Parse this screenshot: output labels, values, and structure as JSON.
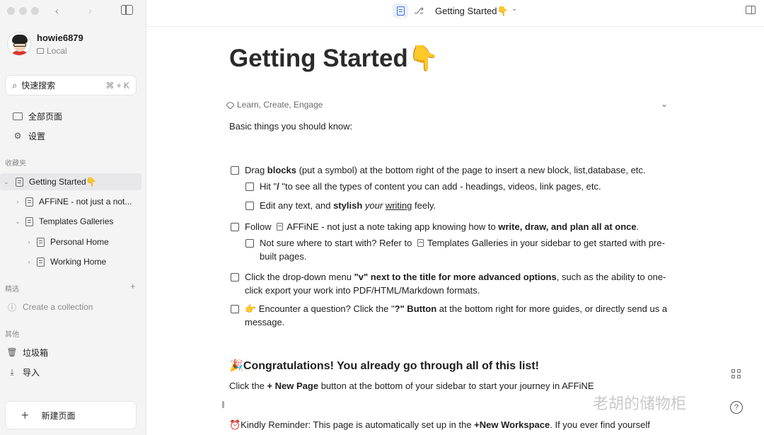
{
  "sidebar": {
    "user": {
      "name": "howie6879",
      "location": "Local"
    },
    "search": {
      "label": "快速搜索",
      "shortcut": "⌘ + K"
    },
    "nav": {
      "all_pages": "全部页面",
      "settings": "设置"
    },
    "favorites_label": "收藏夹",
    "tree": {
      "getting_started": "Getting Started👇",
      "affine": "AFFiNE - not just a not...",
      "templates": "Templates Galleries",
      "personal": "Personal Home",
      "working": "Working Home"
    },
    "collections_label": "精选",
    "create_collection": "Create a collection",
    "others_label": "其他",
    "trash": "垃圾箱",
    "import": "导入",
    "new_page": "新建页面"
  },
  "header": {
    "title": "Getting Started👇"
  },
  "doc": {
    "title": "Getting Started👇",
    "tags": "Learn, Create, Engage",
    "intro": "Basic things you should know:",
    "items": {
      "i1_a": "Drag ",
      "i1_b": "blocks",
      "i1_c": " (put a symbol) at the bottom right of the page to insert a new block, list,database, etc.",
      "i1a_a": "Hit \"",
      "i1a_b": "/",
      "i1a_c": " \"to see all the types of content you can add - headings, videos, link pages, etc.",
      "i1b_a": "Edit any text, and ",
      "i1b_b": "stylish",
      "i1b_c": "your",
      "i1b_d": "writing",
      "i1b_e": " feely.",
      "i2_a": "Follow ",
      "i2_b": "AFFiNE - not just a note taking app",
      "i2_c": "  knowing how to ",
      "i2_d": "write, draw, and plan all at once",
      "i2_e": ".",
      "i2a_a": "Not sure where to start with? Refer to ",
      "i2a_b": "Templates Galleries",
      "i2a_c": "    in your sidebar to get started with pre-built pages.",
      "i3_a": "Click the drop-down menu ",
      "i3_b": "\"v\" next to the title for more advanced options",
      "i3_c": ", such as the ability to one-click export your work into PDF/HTML/Markdown formats.",
      "i4_a": "👉 Encounter a question?  Click the \"",
      "i4_b": "?\" Button",
      "i4_c": " at the bottom right for more guides, or directly send us a message."
    },
    "congrats": "🎉Congratulations! You already go through all of this list!",
    "click_a": "Click the ",
    "click_b": "+ New Page",
    "click_c": " button at the bottom of your sidebar to start your journey in AFFiNE",
    "reminder_a": "⏰Kindly Reminder: This page is automatically set up in the ",
    "reminder_b": "+New Workspace",
    "reminder_c": ". If you ever find yourself"
  },
  "watermark": "老胡的储物柜"
}
